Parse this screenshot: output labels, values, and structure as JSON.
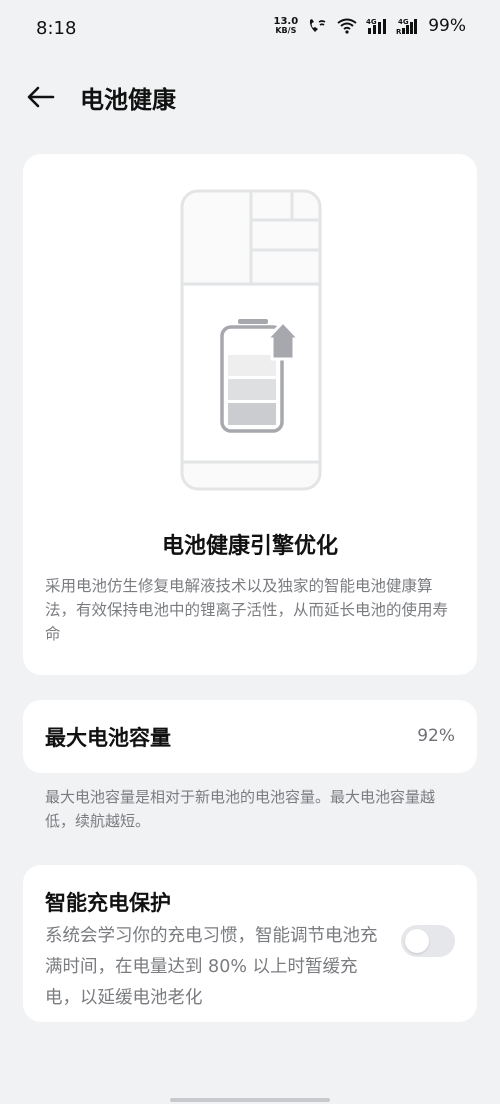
{
  "status": {
    "time": "8:18",
    "net_speed_value": "13.0",
    "net_speed_unit": "KB/S",
    "signal1_label": "4G",
    "signal2_label": "4G",
    "battery": "99%"
  },
  "header": {
    "title": "电池健康"
  },
  "hero": {
    "title": "电池健康引擎优化",
    "description": "采用电池仿生修复电解液技术以及独家的智能电池健康算法，有效保持电池中的锂离子活性，从而延长电池的使用寿命"
  },
  "capacity": {
    "label": "最大电池容量",
    "value": "92%",
    "note": "最大电池容量是相对于新电池的电池容量。最大电池容量越低，续航越短。"
  },
  "smart_charging": {
    "title": "智能充电保护",
    "description": "系统会学习你的充电习惯，智能调节电池充满时间，在电量达到 80% 以上时暂缓充电，以延缓电池老化",
    "enabled": false
  }
}
